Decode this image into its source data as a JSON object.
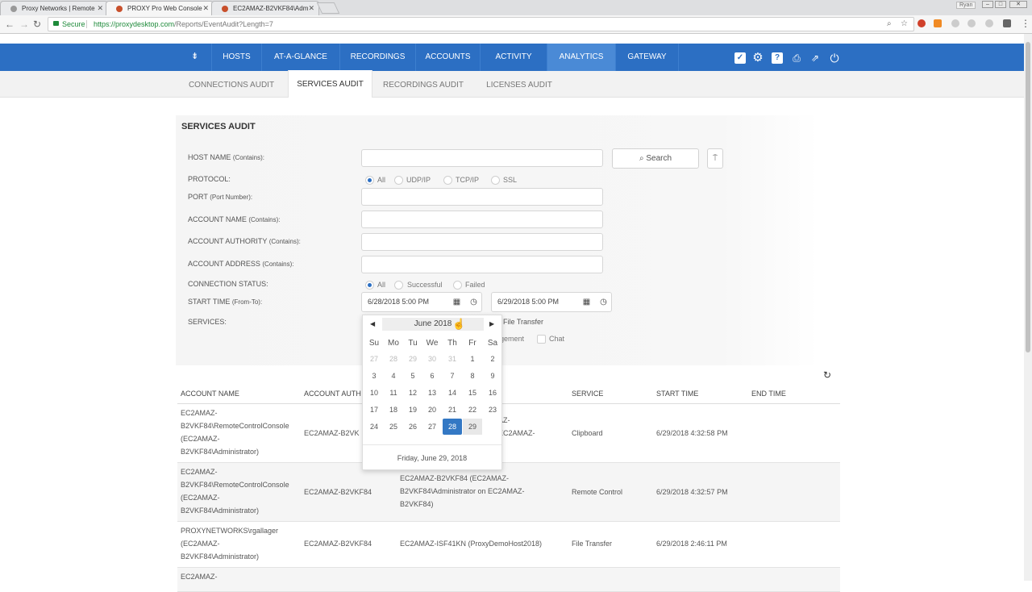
{
  "browser": {
    "tabs": [
      {
        "title": "Proxy Networks | Remote"
      },
      {
        "title": "PROXY Pro Web Console"
      },
      {
        "title": "EC2AMAZ-B2VKF84\\Adm"
      }
    ],
    "user": "Ryan",
    "secure_label": "Secure",
    "url_host": "https://proxydesktop.com",
    "url_path": "/Reports/EventAudit?Length=7"
  },
  "nav": {
    "items": [
      "HOSTS",
      "AT-A-GLANCE",
      "RECORDINGS",
      "ACCOUNTS",
      "ACTIVITY",
      "ANALYTICS",
      "GATEWAY"
    ],
    "active": "ANALYTICS"
  },
  "subnav": {
    "items": [
      "CONNECTIONS AUDIT",
      "SERVICES AUDIT",
      "RECORDINGS AUDIT",
      "LICENSES AUDIT"
    ],
    "active": "SERVICES AUDIT"
  },
  "form": {
    "title": "SERVICES AUDIT",
    "host_name": {
      "label": "HOST NAME",
      "hint": "(Contains):"
    },
    "protocol": {
      "label": "PROTOCOL:",
      "options": [
        "All",
        "UDP/IP",
        "TCP/IP",
        "SSL"
      ],
      "selected": "All"
    },
    "port": {
      "label": "PORT",
      "hint": "(Port Number):"
    },
    "account_name": {
      "label": "ACCOUNT NAME",
      "hint": "(Contains):"
    },
    "account_authority": {
      "label": "ACCOUNT AUTHORITY",
      "hint": "(Contains):"
    },
    "account_address": {
      "label": "ACCOUNT ADDRESS",
      "hint": "(Contains):"
    },
    "connection_status": {
      "label": "CONNECTION STATUS:",
      "options": [
        "All",
        "Successful",
        "Failed"
      ],
      "selected": "All"
    },
    "start_time": {
      "label": "START TIME",
      "hint": "(From-To):",
      "from": "6/28/2018 5:00 PM",
      "to": "6/29/2018 5:00 PM"
    },
    "services": {
      "label": "SERVICES:",
      "visible_options": [
        "File Transfer",
        "gement",
        "Chat"
      ]
    },
    "search_label": "Search"
  },
  "datepicker": {
    "month_label": "June 2018",
    "weekdays": [
      "Su",
      "Mo",
      "Tu",
      "We",
      "Th",
      "Fr",
      "Sa"
    ],
    "weeks": [
      [
        "27",
        "28",
        "29",
        "30",
        "31",
        "1",
        "2"
      ],
      [
        "3",
        "4",
        "5",
        "6",
        "7",
        "8",
        "9"
      ],
      [
        "10",
        "11",
        "12",
        "13",
        "14",
        "15",
        "16"
      ],
      [
        "17",
        "18",
        "19",
        "20",
        "21",
        "22",
        "23"
      ],
      [
        "24",
        "25",
        "26",
        "27",
        "28",
        "29",
        ""
      ]
    ],
    "selected_day": "28",
    "footer": "Friday, June 29, 2018"
  },
  "table": {
    "columns": [
      "ACCOUNT NAME",
      "ACCOUNT AUTH",
      "",
      "SERVICE",
      "START TIME",
      "END TIME"
    ],
    "rows": [
      {
        "account_name": [
          "EC2AMAZ-",
          "B2VKF84\\RemoteControlConsole",
          "(EC2AMAZ-",
          "B2VKF84\\Administrator)"
        ],
        "authority": "EC2AMAZ-B2VK",
        "host": [
          "AZ-",
          "EC2AMAZ-"
        ],
        "service": "Clipboard",
        "start": "6/29/2018 4:32:58 PM",
        "end": ""
      },
      {
        "account_name": [
          "EC2AMAZ-",
          "B2VKF84\\RemoteControlConsole",
          "(EC2AMAZ-",
          "B2VKF84\\Administrator)"
        ],
        "authority": "EC2AMAZ-B2VKF84",
        "host": [
          "EC2AMAZ-B2VKF84 (EC2AMAZ-",
          "B2VKF84\\Administrator on EC2AMAZ-",
          "B2VKF84)"
        ],
        "service": "Remote Control",
        "start": "6/29/2018 4:32:57 PM",
        "end": ""
      },
      {
        "account_name": [
          "PROXYNETWORKS\\rgallager",
          "(EC2AMAZ-",
          "B2VKF84\\Administrator)"
        ],
        "authority": "EC2AMAZ-B2VKF84",
        "host": [
          "EC2AMAZ-ISF41KN (ProxyDemoHost2018)"
        ],
        "service": "File Transfer",
        "start": "6/29/2018 2:46:11 PM",
        "end": ""
      },
      {
        "account_name": [
          "EC2AMAZ-"
        ],
        "authority": "",
        "host": [
          ""
        ],
        "service": "",
        "start": "",
        "end": ""
      }
    ]
  },
  "colors": {
    "brand_blue": "#2c6fc3",
    "selected_day": "#3378c4"
  }
}
